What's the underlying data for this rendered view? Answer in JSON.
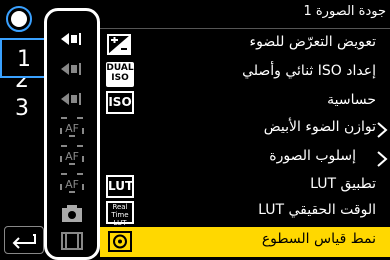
{
  "header": {
    "title": "جودة الصورة",
    "page": "1"
  },
  "tabs": [
    {
      "label": "1",
      "selected": true
    },
    {
      "label": "2",
      "selected": false
    },
    {
      "label": "3",
      "selected": false
    }
  ],
  "icon_column": [
    "exposure-1-icon",
    "exposure-2-icon",
    "exposure-3-icon",
    "af-icon",
    "af-icon",
    "af-icon",
    "camera-icon",
    "film-icon"
  ],
  "menu": [
    {
      "icon": "exposure-comp-icon",
      "label": "تعويض التعرّض للضوء",
      "arrow": false
    },
    {
      "icon": "dual-iso-icon",
      "icon_text": "DUAL ISO",
      "label": "إعداد ISO ثنائي وأصلي",
      "arrow": false
    },
    {
      "icon": "iso-icon",
      "icon_text": "ISO",
      "label": "حساسية",
      "arrow": false
    },
    {
      "icon": "",
      "label": "توازن الضوء الأبيض",
      "arrow": true
    },
    {
      "icon": "",
      "label": "إسلوب الصورة",
      "arrow": true
    },
    {
      "icon": "lut-icon",
      "icon_text": "LUT",
      "label": "تطبيق LUT",
      "arrow": false
    },
    {
      "icon": "realtime-lut-icon",
      "icon_text": "Real Time LUT",
      "label": "الوقت الحقيقي LUT",
      "arrow": false
    },
    {
      "icon": "metering-icon",
      "label": "نمط قياس السطوع",
      "arrow": false,
      "selected": true
    }
  ],
  "colors": {
    "selected": "#ffd800",
    "tab_border": "#3aa1ff"
  }
}
